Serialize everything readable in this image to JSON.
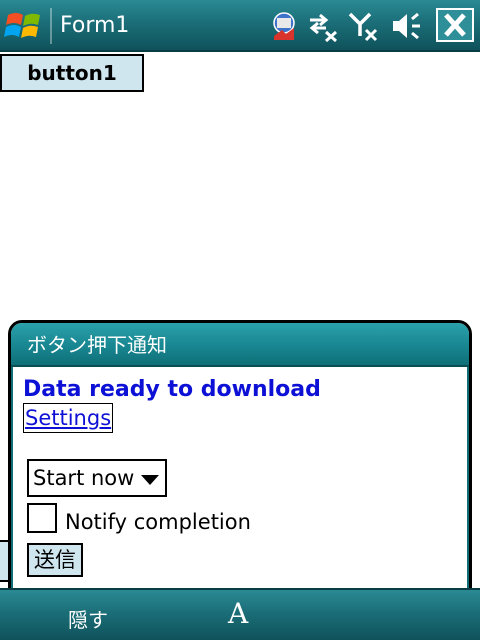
{
  "window": {
    "title": "Form1"
  },
  "status_icons": [
    "phone-tools-icon",
    "connectivity-icon",
    "signal-off-icon",
    "volume-muted-icon"
  ],
  "main": {
    "button1_label": "button1"
  },
  "notification": {
    "title": "ボタン押下通知",
    "heading": "Data ready to download",
    "settings_link": "Settings",
    "select_value": "Start now",
    "checkbox_label": "Notify completion",
    "checkbox_checked": false,
    "send_label": "送信"
  },
  "menubar": {
    "left_softkey": "隠す",
    "sip_label": "A"
  },
  "colors": {
    "accent": "#1b6e78",
    "link": "#0d11d6",
    "button_bg": "#cfe6ef"
  }
}
